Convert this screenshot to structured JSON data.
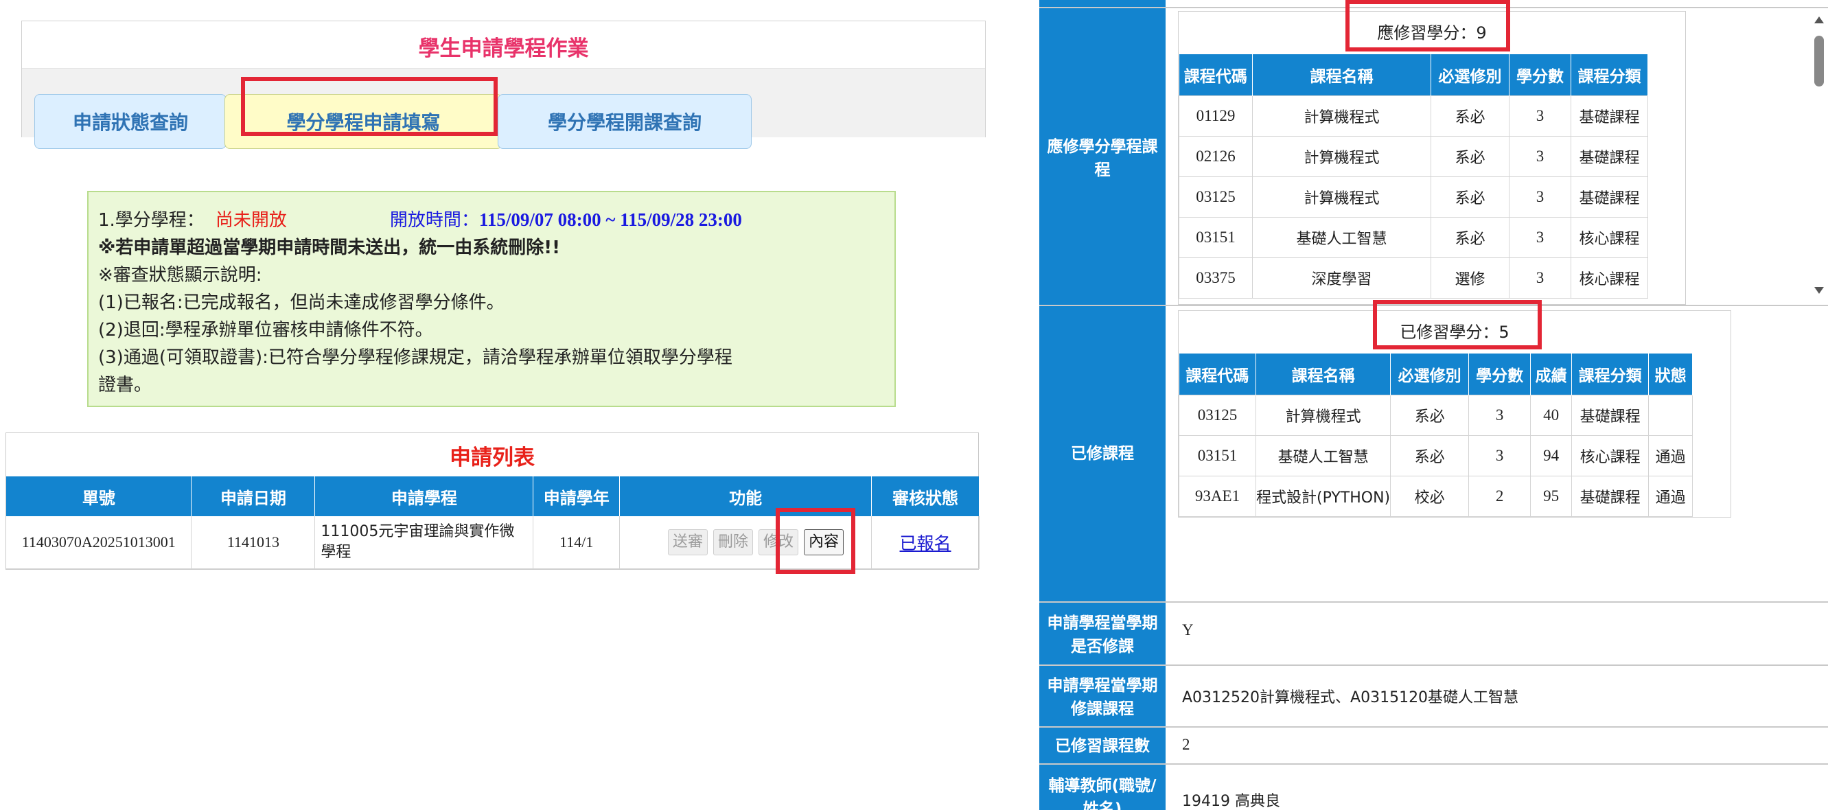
{
  "header": {
    "title": "學生申請學程作業",
    "tabs": [
      {
        "label": "申請狀態查詢"
      },
      {
        "label": "學分學程申請填寫"
      },
      {
        "label": "學分學程開課查詢"
      }
    ]
  },
  "notice": {
    "program_label": "1.學分學程：",
    "program_status": "尚未開放",
    "open_time_label": "開放時間：",
    "open_time_value": "115/09/07 08:00 ~ 115/09/28 23:00",
    "warning": "※若申請單超過當學期申請時間未送出，統一由系統刪除!!",
    "legend_title": "※審查狀態顯示說明:",
    "legend_1": "(1)已報名:已完成報名，但尚未達成修習學分條件。",
    "legend_2": "(2)退回:學程承辦單位審核申請條件不符。",
    "legend_3a": "(3)通過(可領取證書):已符合學分學程修課規定，請洽學程承辦單位領取學分學程",
    "legend_3b": "證書。"
  },
  "application_list": {
    "title": "申請列表",
    "columns": [
      "單號",
      "申請日期",
      "申請學程",
      "申請學年",
      "功能",
      "審核狀態"
    ],
    "row": {
      "id": "11403070A20251013001",
      "date": "1141013",
      "program_line1": "111005元宇宙理論與實作微",
      "program_line2": "學程",
      "year": "114/1",
      "buttons": {
        "submit": "送審",
        "delete": "刪除",
        "edit": "修改",
        "content": "內容"
      },
      "status": "已報名"
    }
  },
  "detail": {
    "required_section": {
      "label_line1": "應修學分學程課",
      "label_line2": "程",
      "title": "應修習學分：9",
      "columns": [
        "課程代碼",
        "課程名稱",
        "必選修別",
        "學分數",
        "課程分類"
      ],
      "rows": [
        [
          "01129",
          "計算機程式",
          "系必",
          "3",
          "基礎課程"
        ],
        [
          "02126",
          "計算機程式",
          "系必",
          "3",
          "基礎課程"
        ],
        [
          "03125",
          "計算機程式",
          "系必",
          "3",
          "基礎課程"
        ],
        [
          "03151",
          "基礎人工智慧",
          "系必",
          "3",
          "核心課程"
        ],
        [
          "03375",
          "深度學習",
          "選修",
          "3",
          "核心課程"
        ]
      ]
    },
    "completed_section": {
      "label": "已修課程",
      "title": "已修習學分：5",
      "columns": [
        "課程代碼",
        "課程名稱",
        "必選修別",
        "學分數",
        "成績",
        "課程分類",
        "狀態"
      ],
      "rows": [
        [
          "03125",
          "計算機程式",
          "系必",
          "3",
          "40",
          "基礎課程",
          ""
        ],
        [
          "03151",
          "基礎人工智慧",
          "系必",
          "3",
          "94",
          "核心課程",
          "通過"
        ],
        [
          "93AE1",
          "程式設計(PYTHON)",
          "校必",
          "2",
          "95",
          "基礎課程",
          "通過"
        ]
      ]
    },
    "fields": [
      {
        "label_line1": "申請學程當學期",
        "label_line2": "是否修課",
        "value": "Y"
      },
      {
        "label_line1": "申請學程當學期",
        "label_line2": "修課課程",
        "value": "A0312520計算機程式、A0315120基礎人工智慧"
      },
      {
        "label_line1": "已修習課程數",
        "label_line2": "",
        "value": "2"
      },
      {
        "label_line1": "輔導教師(職號/",
        "label_line2": "姓名)",
        "value": "19419 高典良"
      }
    ]
  },
  "colors": {
    "accent_blue": "#1384cf",
    "title_pink": "#e8336a",
    "alert_red": "#e8211a",
    "highlight_red": "#e32635",
    "notice_bg": "#ebf8d8"
  }
}
